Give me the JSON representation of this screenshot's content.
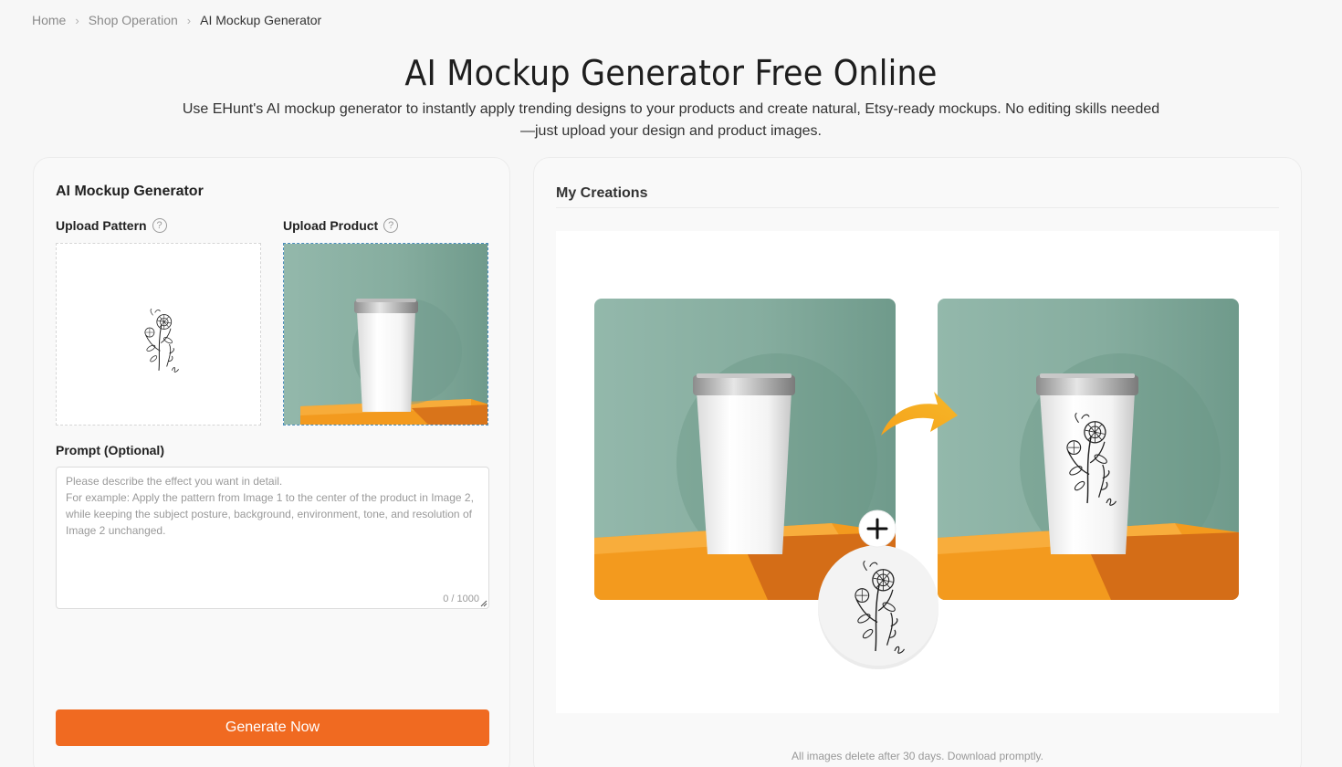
{
  "breadcrumb": {
    "home": "Home",
    "section": "Shop Operation",
    "current": "AI Mockup Generator"
  },
  "header": {
    "title": "AI Mockup Generator Free Online",
    "description": "Use EHunt's AI mockup generator to instantly apply trending designs to your products and create natural, Etsy-ready mockups. No editing skills needed—just upload your design and product images."
  },
  "generator": {
    "title": "AI Mockup Generator",
    "upload_pattern_label": "Upload Pattern",
    "upload_product_label": "Upload Product",
    "help_glyph": "?",
    "prompt_label": "Prompt (Optional)",
    "prompt_placeholder": "Please describe the effect you want in detail.\nFor example: Apply the pattern from Image 1 to the center of the product in Image 2, while keeping the subject posture, background, environment, tone, and resolution of Image 2 unchanged.",
    "prompt_counter": "0 / 1000",
    "generate_label": "Generate Now"
  },
  "creations": {
    "title": "My Creations",
    "note": "All images delete after 30 days. Download promptly."
  },
  "colors": {
    "accent": "#f06a21",
    "mint_bg": "#8fb3a6",
    "pedestal": "#f39a1e"
  },
  "icons": {
    "breadcrumb_separator": "chevron-right-icon",
    "help": "question-circle-icon",
    "plus": "plus-icon",
    "arrow": "curved-arrow-icon"
  }
}
